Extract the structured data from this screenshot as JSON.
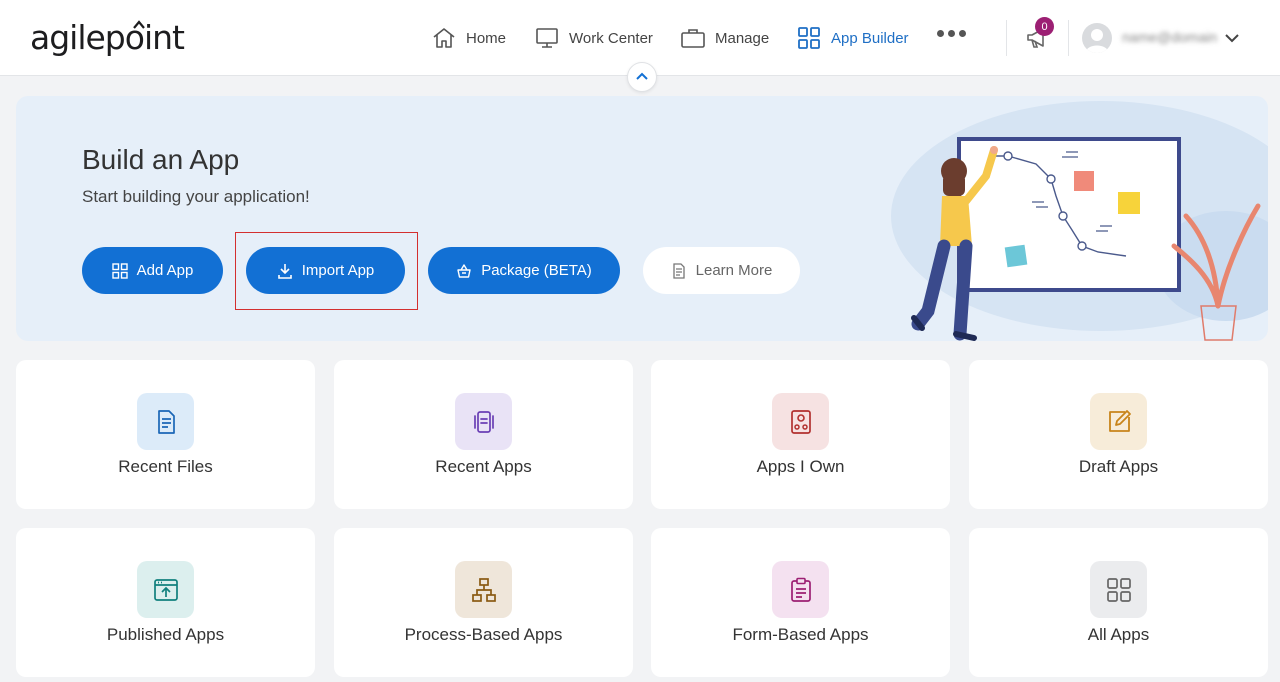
{
  "brand": {
    "name_pre": "agilep",
    "name_post": "int"
  },
  "nav": {
    "home": "Home",
    "work_center": "Work Center",
    "manage": "Manage",
    "app_builder": "App Builder"
  },
  "notifications": {
    "count": "0"
  },
  "user": {
    "name": "name@domain"
  },
  "hero": {
    "title": "Build an App",
    "subtitle": "Start building your application!",
    "add_app": "Add App",
    "import_app": "Import App",
    "package": "Package (BETA)",
    "learn_more": "Learn More"
  },
  "cards": [
    {
      "label": "Recent Files"
    },
    {
      "label": "Recent Apps"
    },
    {
      "label": "Apps I Own"
    },
    {
      "label": "Draft Apps"
    },
    {
      "label": "Published Apps"
    },
    {
      "label": "Process-Based Apps"
    },
    {
      "label": "Form-Based Apps"
    },
    {
      "label": "All Apps"
    }
  ],
  "colors": {
    "primary": "#1270d4",
    "hero_bg": "#e6eff9",
    "highlight": "#d32f2f",
    "badge": "#9c1f73"
  }
}
